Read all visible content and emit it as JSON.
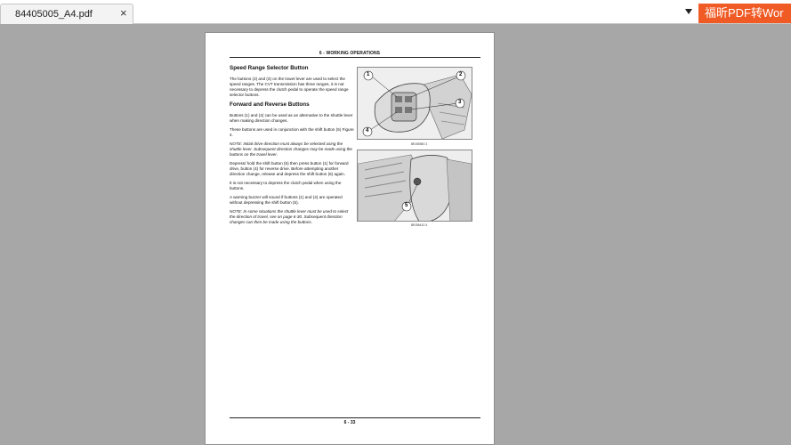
{
  "tab": {
    "filename": "84405005_A4.pdf",
    "close_glyph": "×"
  },
  "promo": {
    "text": "福昕PDF转Wor"
  },
  "page": {
    "header": "6 - WORKING OPERATIONS",
    "footer": "6 - 33",
    "sections": [
      {
        "heading": "Speed Range Selector Button",
        "paragraphs": [
          {
            "text": "The buttons (2) and (3) on the travel lever are used to select the speed ranges. The CVT transmission has three ranges, it is not necessary to depress the clutch pedal to operate the speed range selector buttons.",
            "italic": false
          }
        ]
      },
      {
        "heading": "Forward and Reverse Buttons",
        "paragraphs": [
          {
            "text": "Buttons (1) and (4) can be used as an alternative to the shuttle lever when making direction changes.",
            "italic": false
          },
          {
            "text": "These buttons are used in conjunction with the shift button (5) Figure 4.",
            "italic": false
          },
          {
            "text": "NOTE: Initial drive direction must always be selected using the shuttle lever. Subsequent direction changes may be made using the buttons on the travel lever.",
            "italic": true
          },
          {
            "text": "Depress/ hold the shift button (5) then press button (1) for forward drive, button (4) for reverse drive. Before attempting another direction change, release and depress the shift button (5) again.",
            "italic": false
          },
          {
            "text": "It is not necessary to depress the clutch pedal when using the buttons.",
            "italic": false
          },
          {
            "text": "A warning buzzer will sound if buttons (1) and (4) are operated without depressing the shift button (5).",
            "italic": false
          },
          {
            "text": "NOTE: In some situations the shuttle lever must be used to select the direction of travel, see on page 6-30. Subsequent direction changes can then be made using the buttons.",
            "italic": true
          }
        ]
      }
    ],
    "figures": [
      {
        "caption": "BRJ5598G     3",
        "callouts": [
          "1",
          "2",
          "3",
          "4"
        ]
      },
      {
        "caption": "BRJ5641G     4",
        "callouts": [
          "5"
        ]
      }
    ]
  }
}
